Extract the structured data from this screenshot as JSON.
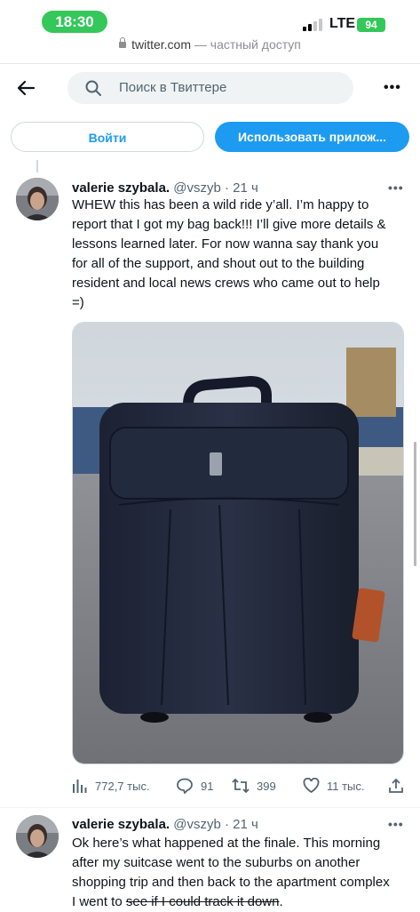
{
  "status_bar": {
    "time": "18:30",
    "network": "LTE",
    "battery": "94"
  },
  "browser": {
    "domain": "twitter.com",
    "separator": " — ",
    "private_label": "частный доступ"
  },
  "header": {
    "search_placeholder": "Поиск в Твиттере"
  },
  "auth": {
    "login_label": "Войти",
    "app_label": "Использовать прилож..."
  },
  "tweets": [
    {
      "name": "valerie szybala.",
      "meta": " @vszyb · 21 ч",
      "lines": [
        "WHEW this has been a wild ride y’all. I’m happy to",
        "report that I got my bag back!!! I’ll give more details &",
        "lessons learned later. For now wanna say thank you",
        "for all of the support, and shout out to the building",
        "resident and local news crews who came out to help",
        "=)"
      ],
      "stats": {
        "views": "772,7 тыс.",
        "replies": "91",
        "retweets": "399",
        "likes": "11 тыс."
      }
    },
    {
      "name": "valerie szybala.",
      "meta": " @vszyb · 21 ч",
      "lines": [
        "Ok here’s what happened at the finale. This morning",
        "after my suitcase went to the suburbs on another",
        "shopping trip and then back to the apartment complex"
      ],
      "last_line_plain": "I went to ",
      "last_line_struck": "see if I could track it down",
      "last_line_end": "."
    }
  ],
  "colors": {
    "accent": "#1d9bf0",
    "status_green": "#34c759",
    "muted": "#536471"
  }
}
